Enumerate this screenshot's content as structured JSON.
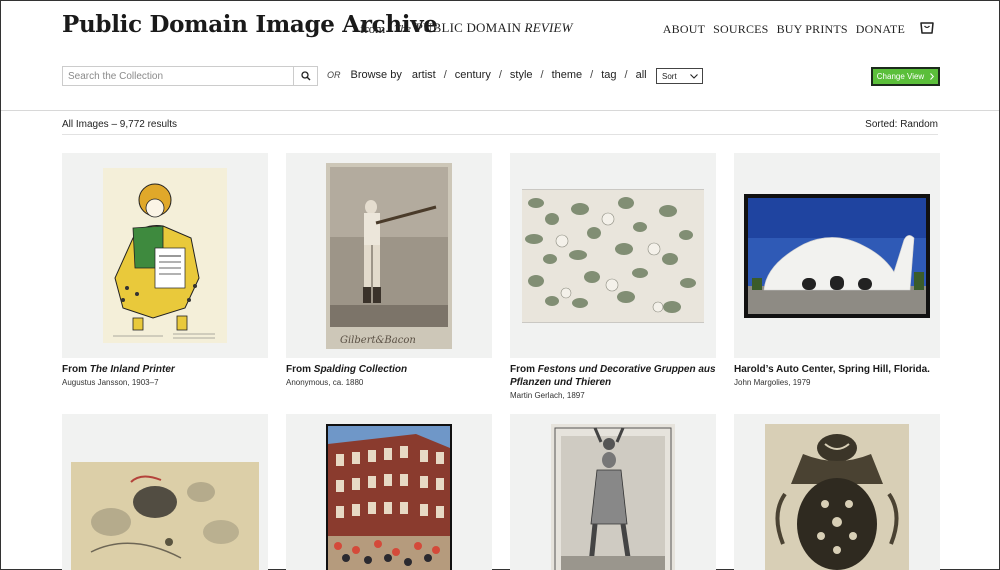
{
  "header": {
    "title": "Public Domain Image Archive",
    "from": "from",
    "logo_the": "The",
    "logo_main": "PUBLIC DOMAIN",
    "logo_review": "REVIEW"
  },
  "nav": {
    "items": [
      "ABOUT",
      "SOURCES",
      "BUY PRINTS",
      "DONATE"
    ]
  },
  "search": {
    "placeholder": "Search the Collection"
  },
  "browse": {
    "or": "OR",
    "label": "Browse by",
    "links": [
      "artist",
      "century",
      "style",
      "theme",
      "tag",
      "all"
    ]
  },
  "sort": {
    "label": "Sort"
  },
  "change_view": {
    "label": "Change View"
  },
  "results": {
    "label": "All Images – 9,772 results",
    "sorted": "Sorted: Random"
  },
  "cards": [
    {
      "prefix": "From ",
      "title": "The Inland Printer",
      "title_italic": true,
      "sub": "Augustus Jansson, 1903–7"
    },
    {
      "prefix": "From ",
      "title": "Spalding Collection",
      "title_italic": true,
      "sub": "Anonymous, ca. 1880"
    },
    {
      "prefix": "From ",
      "title": "Festons und Decorative Gruppen aus Pflanzen und Thieren",
      "title_italic": true,
      "sub": "Martin Gerlach, 1897"
    },
    {
      "prefix": "",
      "title": "Harold’s Auto Center, Spring Hill, Florida.",
      "title_italic": false,
      "sub": "John Margolies, 1979"
    }
  ],
  "colors": {
    "accent": "#5bbf3a",
    "thumb_bg": "#f1f2f1"
  }
}
